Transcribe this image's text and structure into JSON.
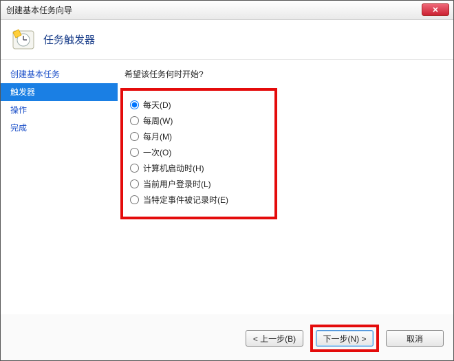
{
  "window": {
    "title": "创建基本任务向导",
    "close_label": "✕"
  },
  "header": {
    "title": "任务触发器"
  },
  "sidebar": {
    "items": [
      {
        "label": "创建基本任务",
        "selected": false
      },
      {
        "label": "触发器",
        "selected": true
      },
      {
        "label": "操作",
        "selected": false
      },
      {
        "label": "完成",
        "selected": false
      }
    ]
  },
  "content": {
    "prompt": "希望该任务何时开始?",
    "options": [
      {
        "label": "每天(D)",
        "checked": true
      },
      {
        "label": "每周(W)",
        "checked": false
      },
      {
        "label": "每月(M)",
        "checked": false
      },
      {
        "label": "一次(O)",
        "checked": false
      },
      {
        "label": "计算机启动时(H)",
        "checked": false
      },
      {
        "label": "当前用户登录时(L)",
        "checked": false
      },
      {
        "label": "当特定事件被记录时(E)",
        "checked": false
      }
    ]
  },
  "footer": {
    "back": "< 上一步(B)",
    "next": "下一步(N) >",
    "cancel": "取消"
  }
}
